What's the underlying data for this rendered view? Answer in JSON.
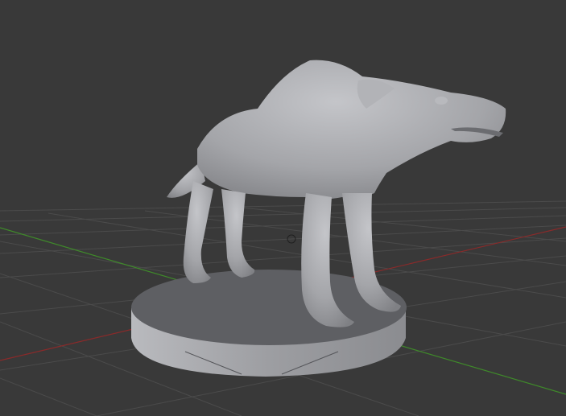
{
  "viewport": {
    "background": "#393939",
    "grid_color": "#4b4b4b",
    "x_axis_color": "#8a2a2a",
    "y_axis_color": "#3f8a2a",
    "model_color": "#a8a9ad",
    "pedestal_top_color": "#5e5f63",
    "pedestal_side_color": "#a0a1a5"
  }
}
